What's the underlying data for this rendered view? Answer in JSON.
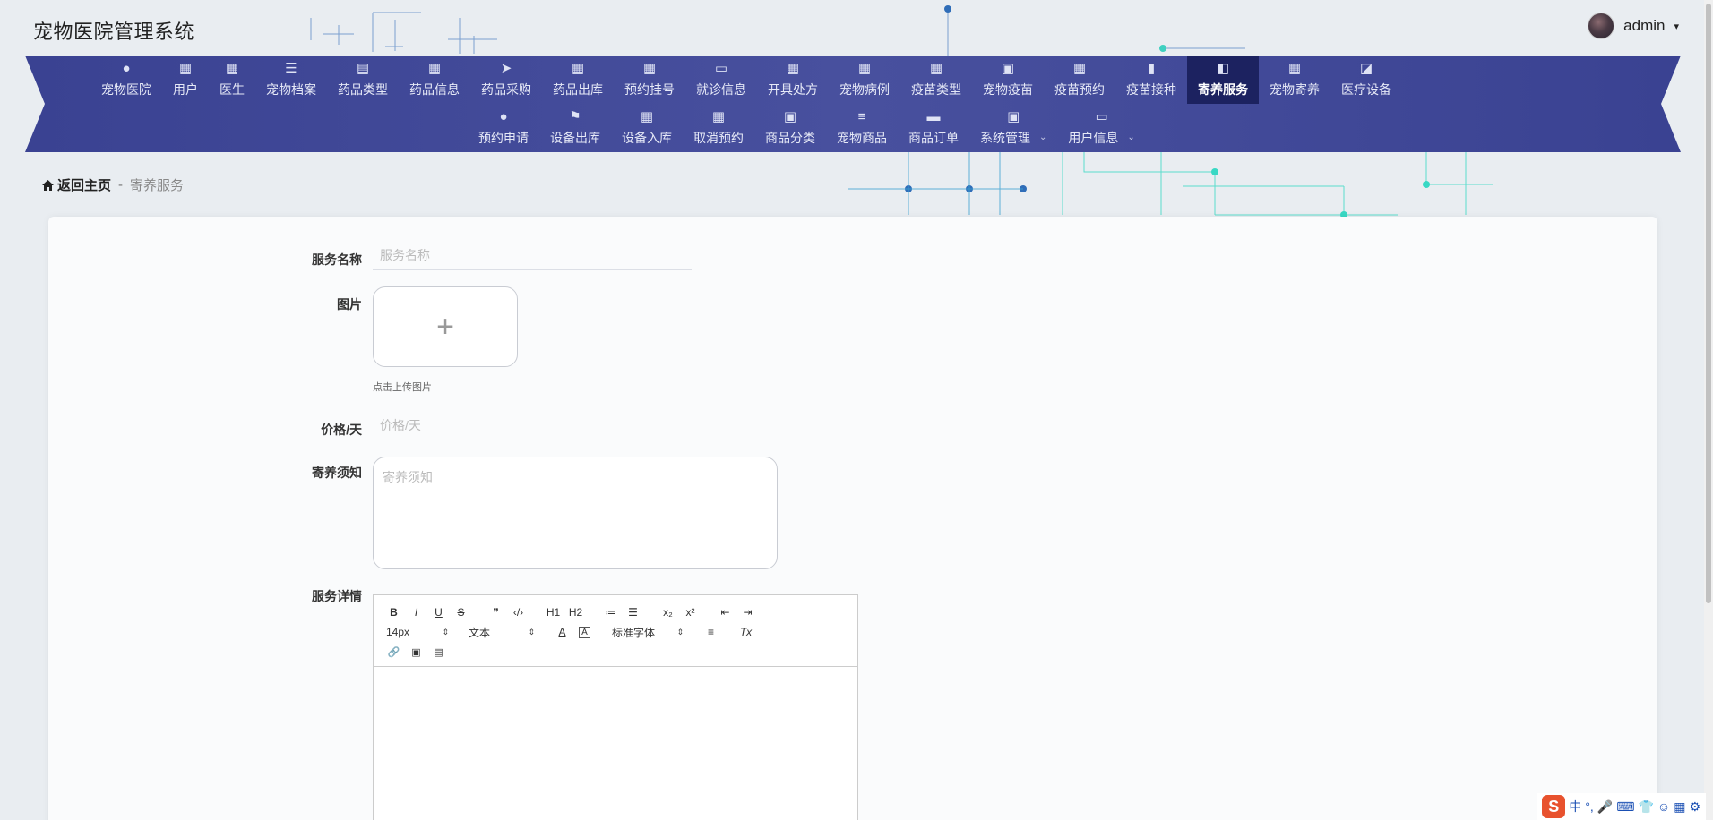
{
  "header": {
    "app_title": "宠物医院管理系统",
    "user_name": "admin",
    "user_caret": "▾"
  },
  "nav": {
    "row1": [
      {
        "label": "宠物医院",
        "icon": "person-icon",
        "glyph": "●"
      },
      {
        "label": "用户",
        "icon": "grid-icon",
        "glyph": "▦"
      },
      {
        "label": "医生",
        "icon": "grid-icon",
        "glyph": "▦"
      },
      {
        "label": "宠物档案",
        "icon": "list-icon",
        "glyph": "☰"
      },
      {
        "label": "药品类型",
        "icon": "inbox-icon",
        "glyph": "▤"
      },
      {
        "label": "药品信息",
        "icon": "grid-icon",
        "glyph": "▦"
      },
      {
        "label": "药品采购",
        "icon": "send-icon",
        "glyph": "➤"
      },
      {
        "label": "药品出库",
        "icon": "grid-icon",
        "glyph": "▦"
      },
      {
        "label": "预约挂号",
        "icon": "grid-icon",
        "glyph": "▦"
      },
      {
        "label": "就诊信息",
        "icon": "monitor-icon",
        "glyph": "▭"
      },
      {
        "label": "开具处方",
        "icon": "grid-icon",
        "glyph": "▦"
      },
      {
        "label": "宠物病例",
        "icon": "grid-icon",
        "glyph": "▦"
      },
      {
        "label": "疫苗类型",
        "icon": "grid-icon",
        "glyph": "▦"
      },
      {
        "label": "宠物疫苗",
        "icon": "clipboard-icon",
        "glyph": "▣"
      },
      {
        "label": "疫苗预约",
        "icon": "grid-icon",
        "glyph": "▦"
      },
      {
        "label": "疫苗接种",
        "icon": "bar-chart-icon",
        "glyph": "▮"
      },
      {
        "label": "寄养服务",
        "icon": "wallet-icon",
        "glyph": "◧",
        "active": true
      },
      {
        "label": "宠物寄养",
        "icon": "grid-icon",
        "glyph": "▦"
      },
      {
        "label": "医疗设备",
        "icon": "line-chart-icon",
        "glyph": "◪"
      }
    ],
    "row2": [
      {
        "label": "预约申请",
        "icon": "lightbulb-icon",
        "glyph": "●"
      },
      {
        "label": "设备出库",
        "icon": "flag-icon",
        "glyph": "⚑"
      },
      {
        "label": "设备入库",
        "icon": "grid-icon",
        "glyph": "▦"
      },
      {
        "label": "取消预约",
        "icon": "grid-icon",
        "glyph": "▦"
      },
      {
        "label": "商品分类",
        "icon": "clipboard-x-icon",
        "glyph": "▣"
      },
      {
        "label": "宠物商品",
        "icon": "sliders-icon",
        "glyph": "≡"
      },
      {
        "label": "商品订单",
        "icon": "comment-icon",
        "glyph": "▬"
      },
      {
        "label": "系统管理",
        "icon": "clipboard-check-icon",
        "glyph": "▣",
        "dropdown": "⌄"
      },
      {
        "label": "用户信息",
        "icon": "card-icon",
        "glyph": "▭",
        "dropdown": "⌄"
      }
    ]
  },
  "breadcrumb": {
    "home": "返回主页",
    "separator": "-",
    "current": "寄养服务"
  },
  "form": {
    "service_name_label": "服务名称",
    "service_name_placeholder": "服务名称",
    "service_name_value": "",
    "image_label": "图片",
    "upload_plus": "+",
    "upload_tip": "点击上传图片",
    "price_label": "价格/天",
    "price_placeholder": "价格/天",
    "price_value": "",
    "notice_label": "寄养须知",
    "notice_placeholder": "寄养须知",
    "detail_label": "服务详情"
  },
  "editor": {
    "row1": [
      "B",
      "I",
      "U",
      "S",
      "❞",
      "‹/›",
      "H1",
      "H2",
      "≔",
      "☰",
      "x₂",
      "x²",
      "⇤",
      "⇥"
    ],
    "font_size": "14px",
    "header_select": "文本",
    "color_btn": "A",
    "bg_btn": "A",
    "font_family": "标准字体",
    "align_btn": "≡",
    "clear_btn": "Tx",
    "row3": [
      "🔗",
      "▣",
      "▤"
    ]
  },
  "ime": {
    "logo": "S",
    "lang": "中",
    "punct": "°,",
    "mic": "🎤",
    "kbd": "⌨",
    "skin": "👕",
    "face": "☺",
    "apps": "▦",
    "gear": "⚙"
  },
  "colors": {
    "nav_bg": "#3b4495",
    "nav_active": "#1c2260",
    "page_bg": "#e9edf1"
  }
}
